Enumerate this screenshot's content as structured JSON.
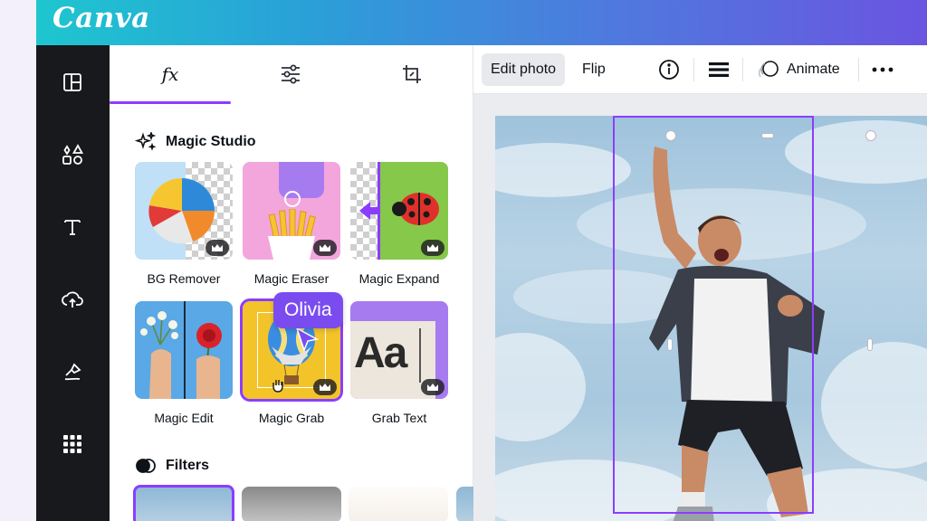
{
  "app": {
    "logo": "Canva"
  },
  "side_rail": [
    {
      "name": "design",
      "icon": "layout-icon"
    },
    {
      "name": "elements",
      "icon": "shapes-icon"
    },
    {
      "name": "text",
      "icon": "text-icon"
    },
    {
      "name": "uploads",
      "icon": "cloud-upload-icon"
    },
    {
      "name": "draw",
      "icon": "draw-icon"
    },
    {
      "name": "apps",
      "icon": "apps-grid-icon"
    }
  ],
  "panel": {
    "tabs": [
      {
        "name": "effects",
        "icon": "fx-icon",
        "label": "fx",
        "active": true
      },
      {
        "name": "adjust",
        "icon": "sliders-icon",
        "active": false
      },
      {
        "name": "crop",
        "icon": "crop-icon",
        "active": false
      }
    ],
    "magic_studio": {
      "title": "Magic Studio",
      "tools": [
        {
          "label": "BG Remover",
          "premium": true
        },
        {
          "label": "Magic Eraser",
          "premium": true
        },
        {
          "label": "Magic Expand",
          "premium": true
        },
        {
          "label": "Magic Edit",
          "premium": false
        },
        {
          "label": "Magic Grab",
          "premium": true,
          "selected": true
        },
        {
          "label": "Grab Text",
          "premium": true
        }
      ]
    },
    "filters": {
      "title": "Filters"
    }
  },
  "collaborator": {
    "name": "Olivia",
    "color": "#7a4cf0"
  },
  "toolbar": {
    "edit_photo": "Edit photo",
    "flip": "Flip",
    "animate": "Animate"
  },
  "colors": {
    "accent": "#8b3dff",
    "rail_bg": "#17191c",
    "gradient_start": "#1ec6cf",
    "gradient_end": "#6a55e0"
  }
}
